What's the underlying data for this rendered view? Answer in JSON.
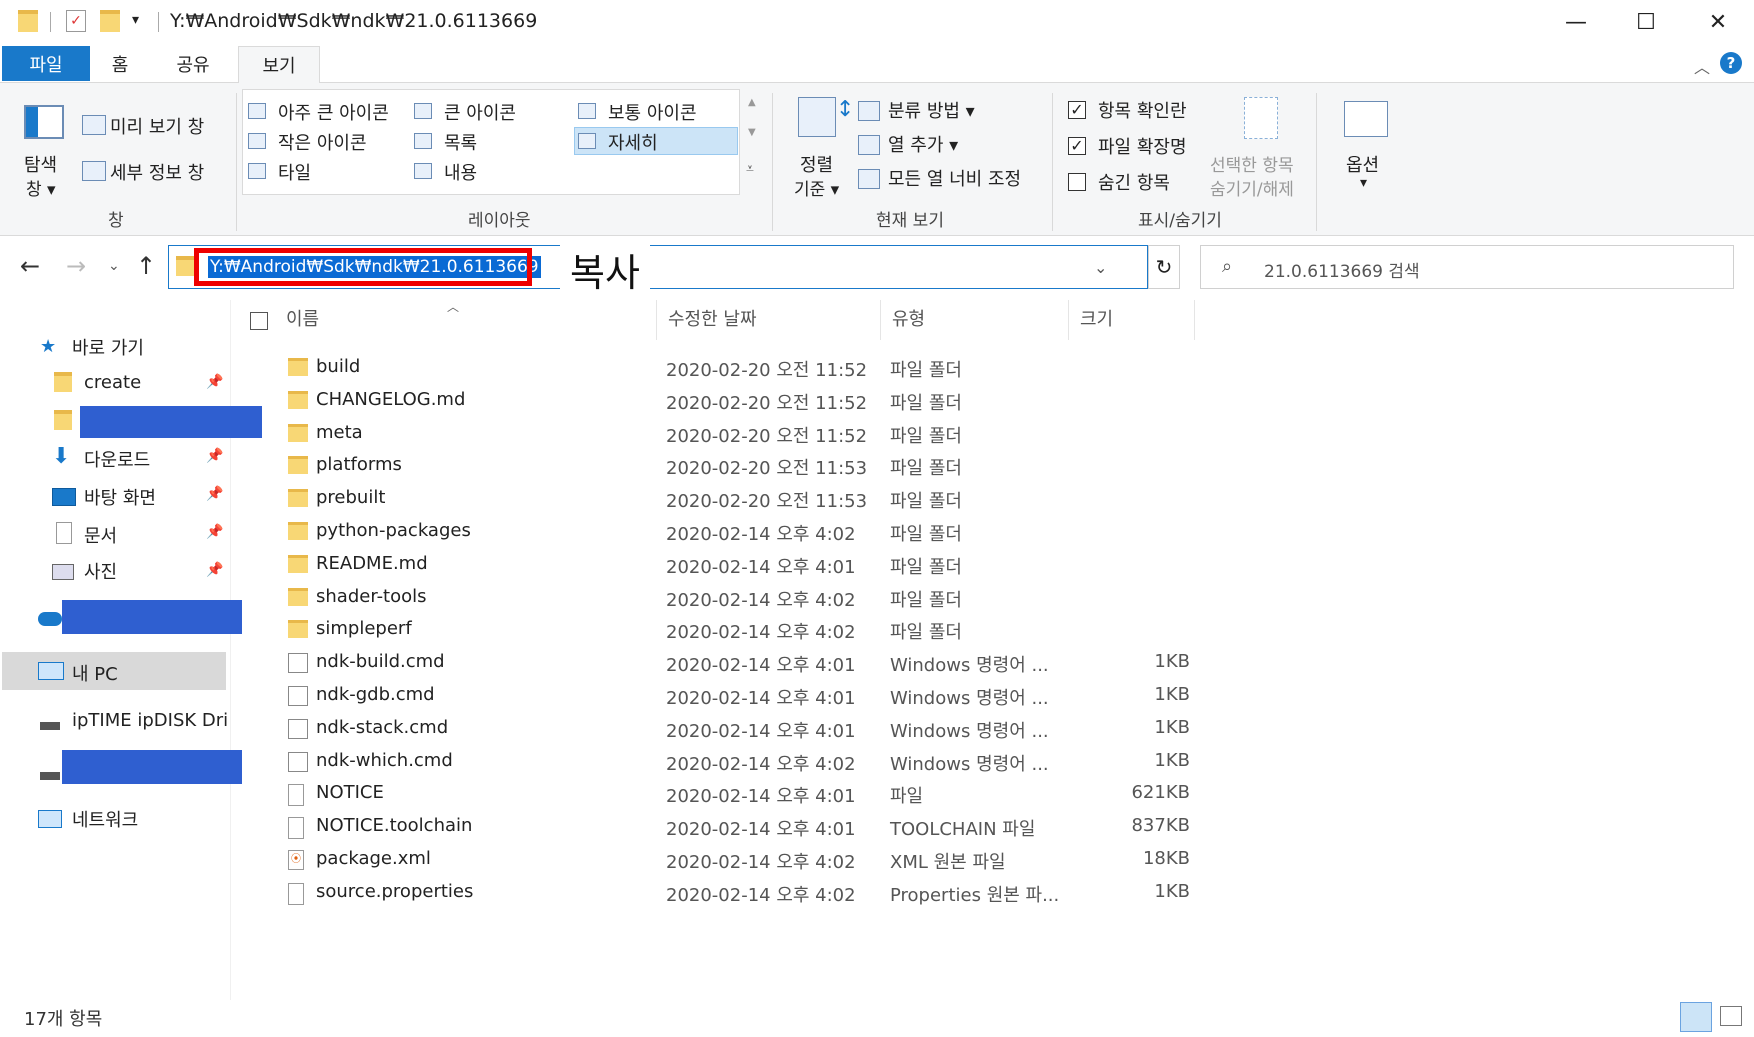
{
  "titlebar": {
    "path": "Y:₩Android₩Sdk₩ndk₩21.0.6113669",
    "minimize": "—",
    "maximize": "☐",
    "close": "✕"
  },
  "tabs": [
    {
      "label": "파일"
    },
    {
      "label": "홈"
    },
    {
      "label": "공유"
    },
    {
      "label": "보기"
    }
  ],
  "ribbon": {
    "pane_group": {
      "nav_pane_line1": "탐색",
      "nav_pane_line2": "창 ▾",
      "preview_pane": "미리 보기 창",
      "details_pane": "세부 정보 창",
      "label": "창"
    },
    "layout_group": {
      "items": [
        "아주 큰 아이콘",
        "큰 아이콘",
        "보통 아이콘",
        "작은 아이콘",
        "목록",
        "자세히",
        "타일",
        "내용"
      ],
      "label": "레이아웃"
    },
    "current_view_group": {
      "sort_line1": "정렬",
      "sort_line2": "기준 ▾",
      "group_by": "분류 방법 ▾",
      "add_columns": "열 추가 ▾",
      "size_columns": "모든 열 너비 조정",
      "label": "현재 보기"
    },
    "show_hide_group": {
      "item_checkboxes": "항목 확인란",
      "file_extensions": "파일 확장명",
      "hidden_items": "숨긴 항목",
      "hide_selected_line1": "선택한 항목",
      "hide_selected_line2": "숨기기/해제",
      "label": "표시/숨기기",
      "item_checkboxes_checked": true,
      "file_extensions_checked": true,
      "hidden_items_checked": false
    },
    "options": {
      "label": "옵션",
      "arrow": "▾"
    }
  },
  "address": {
    "path": "Y:₩Android₩Sdk₩ndk₩21.0.6113669",
    "annotation": "복사",
    "search_placeholder": "21.0.6113669 검색"
  },
  "nav_pane": {
    "quick_access": "바로 가기",
    "items": [
      {
        "label": "create"
      },
      {
        "label": "다운로드"
      },
      {
        "label": "바탕 화면"
      },
      {
        "label": "문서"
      },
      {
        "label": "사진"
      }
    ],
    "this_pc": "내 PC",
    "drive": "ipTIME ipDISK Driv",
    "network": "네트워크"
  },
  "columns": {
    "name": "이름",
    "date": "수정한 날짜",
    "type": "유형",
    "size": "크기"
  },
  "files": [
    {
      "name": "build",
      "date": "2020-02-20 오전 11:52",
      "type": "파일 폴더",
      "size": "",
      "kind": "folder"
    },
    {
      "name": "CHANGELOG.md",
      "date": "2020-02-20 오전 11:52",
      "type": "파일 폴더",
      "size": "",
      "kind": "folder"
    },
    {
      "name": "meta",
      "date": "2020-02-20 오전 11:52",
      "type": "파일 폴더",
      "size": "",
      "kind": "folder"
    },
    {
      "name": "platforms",
      "date": "2020-02-20 오전 11:53",
      "type": "파일 폴더",
      "size": "",
      "kind": "folder"
    },
    {
      "name": "prebuilt",
      "date": "2020-02-20 오전 11:53",
      "type": "파일 폴더",
      "size": "",
      "kind": "folder"
    },
    {
      "name": "python-packages",
      "date": "2020-02-14 오후 4:02",
      "type": "파일 폴더",
      "size": "",
      "kind": "folder"
    },
    {
      "name": "README.md",
      "date": "2020-02-14 오후 4:01",
      "type": "파일 폴더",
      "size": "",
      "kind": "folder"
    },
    {
      "name": "shader-tools",
      "date": "2020-02-14 오후 4:02",
      "type": "파일 폴더",
      "size": "",
      "kind": "folder"
    },
    {
      "name": "simpleperf",
      "date": "2020-02-14 오후 4:02",
      "type": "파일 폴더",
      "size": "",
      "kind": "folder"
    },
    {
      "name": "ndk-build.cmd",
      "date": "2020-02-14 오후 4:01",
      "type": "Windows 명령어 ...",
      "size": "1KB",
      "kind": "cmd"
    },
    {
      "name": "ndk-gdb.cmd",
      "date": "2020-02-14 오후 4:01",
      "type": "Windows 명령어 ...",
      "size": "1KB",
      "kind": "cmd"
    },
    {
      "name": "ndk-stack.cmd",
      "date": "2020-02-14 오후 4:01",
      "type": "Windows 명령어 ...",
      "size": "1KB",
      "kind": "cmd"
    },
    {
      "name": "ndk-which.cmd",
      "date": "2020-02-14 오후 4:02",
      "type": "Windows 명령어 ...",
      "size": "1KB",
      "kind": "cmd"
    },
    {
      "name": "NOTICE",
      "date": "2020-02-14 오후 4:01",
      "type": "파일",
      "size": "621KB",
      "kind": "file"
    },
    {
      "name": "NOTICE.toolchain",
      "date": "2020-02-14 오후 4:01",
      "type": "TOOLCHAIN 파일",
      "size": "837KB",
      "kind": "file"
    },
    {
      "name": "package.xml",
      "date": "2020-02-14 오후 4:02",
      "type": "XML 원본 파일",
      "size": "18KB",
      "kind": "xml"
    },
    {
      "name": "source.properties",
      "date": "2020-02-14 오후 4:02",
      "type": "Properties 원본 파...",
      "size": "1KB",
      "kind": "file"
    }
  ],
  "status": {
    "count": "17개 항목"
  }
}
